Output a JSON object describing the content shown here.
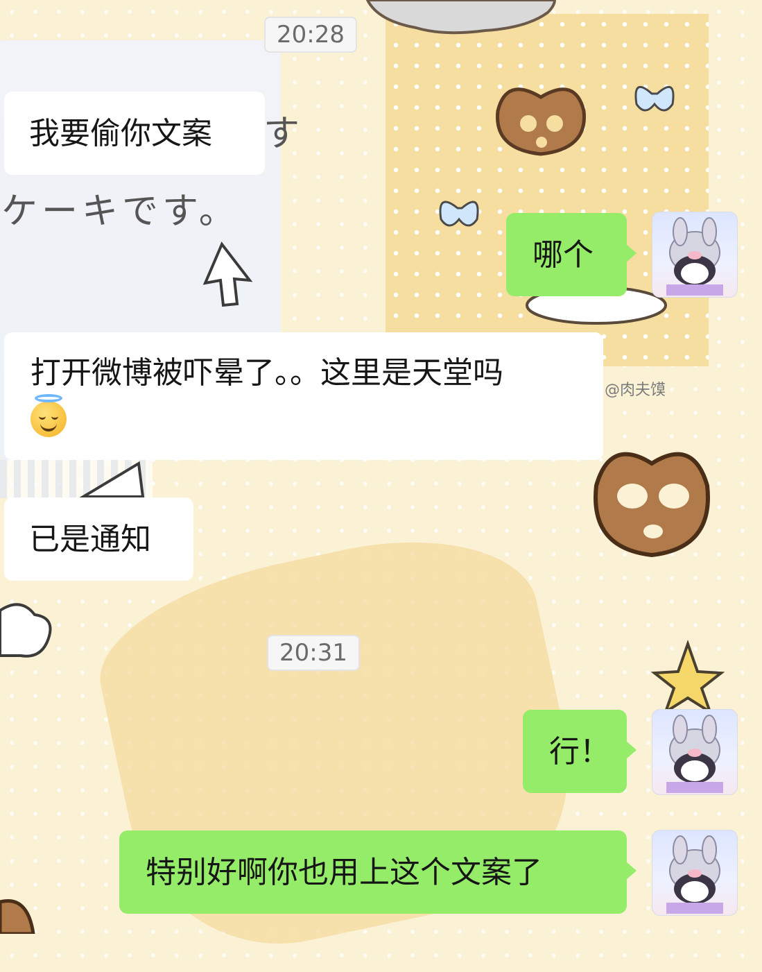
{
  "chat": {
    "timestamps": [
      "20:28",
      "20:31"
    ],
    "messages": [
      {
        "text": "我要偷你文案"
      },
      {
        "text": "哪个"
      },
      {
        "text": "打开微博被吓晕了。。这里是天堂吗",
        "emoji": "smiling-face-with-halo-emoji"
      },
      {
        "text": "已是通知"
      },
      {
        "text": "行！"
      },
      {
        "text": "特别好啊你也用上这个文案了"
      }
    ]
  },
  "wallpaper": {
    "watermark": "@肉夫馍",
    "jp_lines": [
      "す",
      "ケーキです。"
    ]
  },
  "colors": {
    "outgoing_bubble": "#95ec69",
    "incoming_bubble": "#ffffff",
    "background": "#fbf2d6"
  },
  "icons": [
    "avatar-image",
    "smiling-face-with-halo-emoji"
  ]
}
